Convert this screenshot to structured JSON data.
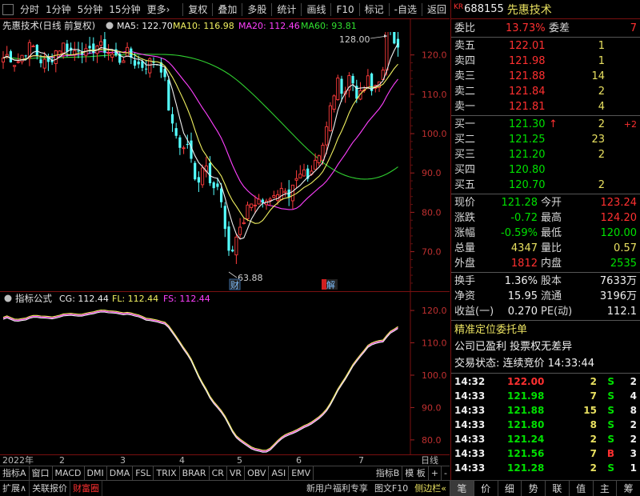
{
  "toolbar": {
    "left_items": [
      "分时",
      "1分钟",
      "5分钟",
      "15分钟",
      "更多"
    ],
    "more_arrow": "›",
    "right_items": [
      "复权",
      "叠加",
      "多股",
      "统计",
      "画线",
      "F10",
      "标记",
      "-自选",
      "返回"
    ]
  },
  "main_chart": {
    "title": "先惠技术(日线 前复权)",
    "ma_legend": [
      {
        "label": "MA5: 122.70",
        "color": "#f0f0f0"
      },
      {
        "label": "MA10: 116.98",
        "color": "#f0f060"
      },
      {
        "label": "MA20: 112.46",
        "color": "#ff40ff"
      },
      {
        "label": "MA60: 93.81",
        "color": "#30e030"
      }
    ],
    "y_labels": [
      "120.0",
      "110.0",
      "100.0",
      "90.0",
      "80.0",
      "70.0"
    ],
    "high_label": "128.00",
    "low_label": "63.88",
    "marker_cai": "财",
    "marker_jie": "解"
  },
  "indicator": {
    "title": "指标公式",
    "legend": [
      {
        "label": "CG: 112.44",
        "color": "#f0f0f0"
      },
      {
        "label": "FL: 112.44",
        "color": "#f0f060"
      },
      {
        "label": "FS: 112.44",
        "color": "#ff40ff"
      }
    ],
    "y_labels": [
      "120.0",
      "110.0",
      "100.0",
      "90.0",
      "80.0"
    ]
  },
  "date_axis": {
    "labels": [
      "2022年",
      "2",
      "3",
      "4",
      "5",
      "6",
      "7"
    ],
    "period_label": "日线"
  },
  "indicator_tabs": [
    "指标A",
    "窗口",
    "MACD",
    "DMI",
    "DMA",
    "FSL",
    "TRIX",
    "BRAR",
    "CR",
    "VR",
    "OBV",
    "ASI",
    "EMV",
    "指标B",
    "模 板",
    "+",
    "-"
  ],
  "bottom_bar": {
    "left": [
      "扩展∧",
      "关联报价",
      "财富圈"
    ],
    "active_index": 2,
    "right": [
      "新用户福利专享",
      "图文F10",
      "侧边栏«"
    ],
    "icons": [
      "笔",
      "价",
      "细",
      "势",
      "联",
      "值",
      "主",
      "筹"
    ]
  },
  "stock": {
    "market_tag": "KR",
    "code": "688155",
    "name": "先惠技术"
  },
  "weibi": {
    "label": "委比",
    "value": "13.73%",
    "label2": "委差",
    "value2": "7"
  },
  "asks": [
    {
      "label": "卖五",
      "price": "122.01",
      "vol": "1"
    },
    {
      "label": "卖四",
      "price": "121.98",
      "vol": "1"
    },
    {
      "label": "卖三",
      "price": "121.88",
      "vol": "14"
    },
    {
      "label": "卖二",
      "price": "121.84",
      "vol": "2"
    },
    {
      "label": "卖一",
      "price": "121.81",
      "vol": "4"
    }
  ],
  "bids": [
    {
      "label": "买一",
      "price": "121.30",
      "vol": "2",
      "change": "+2",
      "arrow": "↑"
    },
    {
      "label": "买二",
      "price": "121.25",
      "vol": "23",
      "change": "",
      "arrow": ""
    },
    {
      "label": "买三",
      "price": "121.20",
      "vol": "2",
      "change": "",
      "arrow": ""
    },
    {
      "label": "买四",
      "price": "120.80",
      "vol": "",
      "change": "",
      "arrow": ""
    },
    {
      "label": "买五",
      "price": "120.70",
      "vol": "2",
      "change": "",
      "arrow": ""
    }
  ],
  "quote": [
    {
      "l1": "现价",
      "v1": "121.28",
      "l2": "今开",
      "v2": "123.24",
      "c1": "grn",
      "c2": "red"
    },
    {
      "l1": "涨跌",
      "v1": "-0.72",
      "l2": "最高",
      "v2": "124.20",
      "c1": "grn",
      "c2": "red"
    },
    {
      "l1": "涨幅",
      "v1": "-0.59%",
      "l2": "最低",
      "v2": "120.00",
      "c1": "grn",
      "c2": "grn"
    },
    {
      "l1": "总量",
      "v1": "4347",
      "l2": "量比",
      "v2": "0.57",
      "c1": "yel",
      "c2": "yel"
    },
    {
      "l1": "外盘",
      "v1": "1812",
      "l2": "内盘",
      "v2": "2535",
      "c1": "red",
      "c2": "grn"
    }
  ],
  "stats": [
    {
      "l1": "换手",
      "v1": "1.36%",
      "l2": "股本",
      "v2": "7633万"
    },
    {
      "l1": "净资",
      "v1": "15.95",
      "l2": "流通",
      "v2": "3196万"
    },
    {
      "l1": "收益(一)",
      "v1": "0.270",
      "l2": "PE(动)",
      "v2": "112.1"
    }
  ],
  "precise": "精准定位委托单",
  "company_note": "公司已盈利 投票权无差异",
  "trade_status": "交易状态: 连续竞价 14:33:44",
  "ticks": [
    {
      "time": "14:32",
      "price": "122.00",
      "vol": "2",
      "side": "S",
      "n": "2",
      "pc": "red",
      "sc": "grn"
    },
    {
      "time": "14:33",
      "price": "121.98",
      "vol": "7",
      "side": "S",
      "n": "4",
      "pc": "grn",
      "sc": "grn"
    },
    {
      "time": "14:33",
      "price": "121.88",
      "vol": "15",
      "side": "S",
      "n": "8",
      "pc": "grn",
      "sc": "grn"
    },
    {
      "time": "14:33",
      "price": "121.80",
      "vol": "8",
      "side": "S",
      "n": "2",
      "pc": "grn",
      "sc": "grn"
    },
    {
      "time": "14:33",
      "price": "121.24",
      "vol": "2",
      "side": "S",
      "n": "2",
      "pc": "grn",
      "sc": "grn"
    },
    {
      "time": "14:33",
      "price": "121.56",
      "vol": "7",
      "side": "B",
      "n": "3",
      "pc": "grn",
      "sc": "red"
    },
    {
      "time": "14:33",
      "price": "121.28",
      "vol": "2",
      "side": "S",
      "n": "1",
      "pc": "grn",
      "sc": "grn"
    }
  ]
}
